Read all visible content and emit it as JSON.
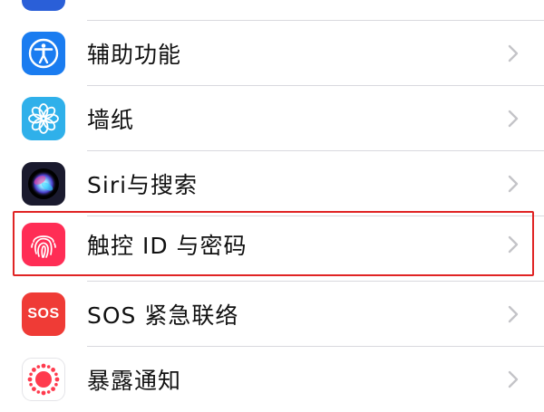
{
  "colors": {
    "accessibility_icon_bg": "#1a7cf0",
    "wallpaper_icon_bg": "#2fb0ea",
    "siri_icon_bg": "#1a1a2e",
    "touchid_icon_bg": "#ff2d55",
    "sos_icon_bg": "#ef3b36",
    "exposure_icon_bg": "#ffffff",
    "highlight_border": "#e02424",
    "chevron": "#c4c4c8"
  },
  "settings": {
    "items": [
      {
        "label": "辅助功能",
        "icon": "accessibility-icon"
      },
      {
        "label": "墙纸",
        "icon": "wallpaper-flower-icon"
      },
      {
        "label": "Siri与搜索",
        "icon": "siri-icon"
      },
      {
        "label": "触控 ID 与密码",
        "icon": "fingerprint-icon",
        "highlighted": true
      },
      {
        "label": "SOS 紧急联络",
        "icon": "sos-icon",
        "icon_text": "SOS"
      },
      {
        "label": "暴露通知",
        "icon": "exposure-notification-icon"
      }
    ]
  }
}
